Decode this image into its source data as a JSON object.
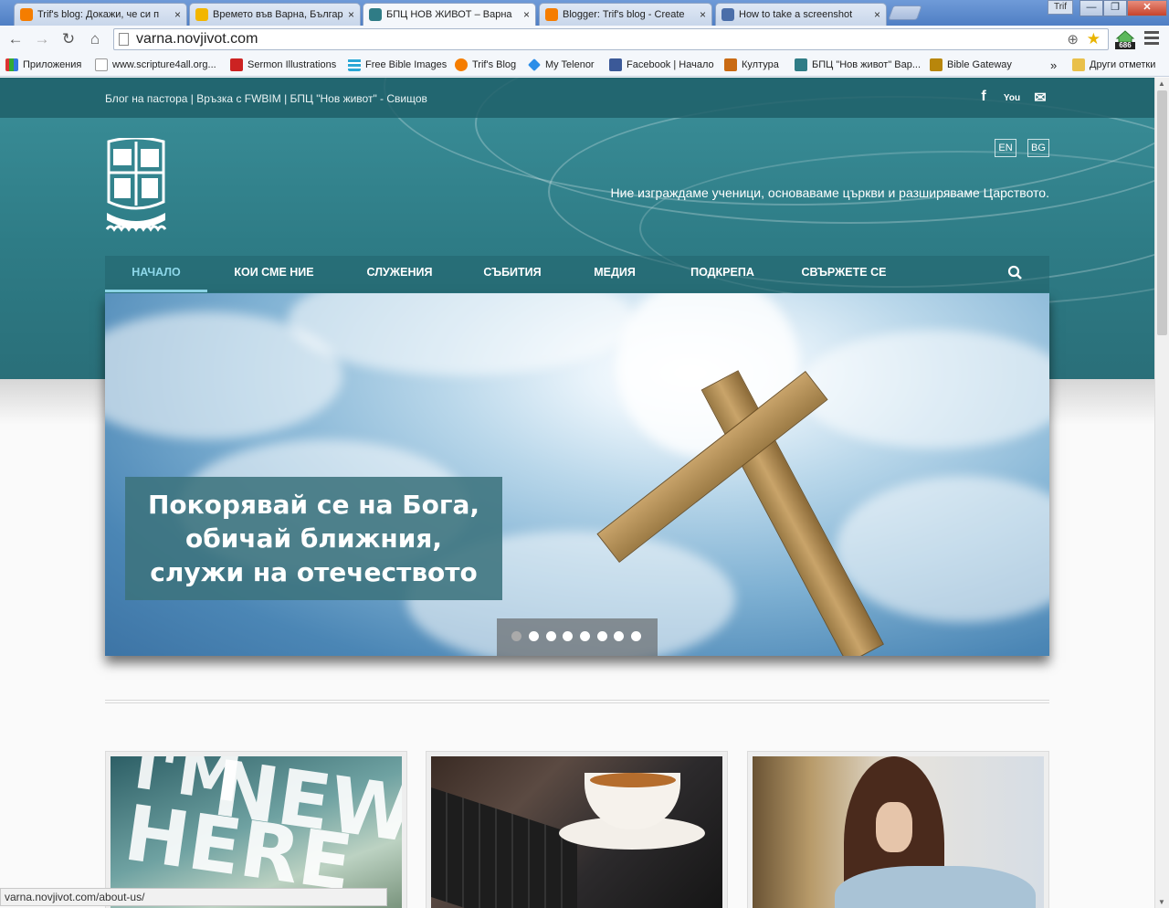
{
  "browser": {
    "tabs": [
      {
        "title": "Trif's blog: Докажи, че си п",
        "favicon_color": "#f57d00",
        "active": false
      },
      {
        "title": "Времето във Варна, Българ",
        "favicon_color": "#f2b600",
        "active": false
      },
      {
        "title": "БПЦ НОВ ЖИВОТ – Варна",
        "favicon_color": "#2f7c86",
        "active": true
      },
      {
        "title": "Blogger: Trif's blog - Create ",
        "favicon_color": "#f57d00",
        "active": false
      },
      {
        "title": "How to take a screenshot",
        "favicon_color": "#4a6ea9",
        "active": false
      }
    ],
    "tab_close": "×",
    "profile_label": "Trif",
    "window_controls": {
      "minimize": "—",
      "restore": "❐",
      "close": "✕"
    },
    "url": "varna.novjivot.com",
    "extension_badge": "686",
    "nav_icons": {
      "back": "←",
      "forward": "→",
      "reload": "↻",
      "home": "⌂"
    },
    "omnibox_icons": {
      "zoom": "⊕",
      "star": "★"
    },
    "bookmarks": [
      {
        "label": "Приложения",
        "icon_color": "#d33"
      },
      {
        "label": "www.scripture4all.org...",
        "icon_color": "#ffffff"
      },
      {
        "label": "Sermon Illustrations",
        "icon_color": "#c22"
      },
      {
        "label": "Free Bible Images",
        "icon_color": "#2aa7d6"
      },
      {
        "label": "Trif's Blog",
        "icon_color": "#f57d00"
      },
      {
        "label": "My Telenor",
        "icon_color": "#2b8ee8"
      },
      {
        "label": "Facebook | Начало",
        "icon_color": "#3b5998"
      },
      {
        "label": "Култура",
        "icon_color": "#c96a13"
      },
      {
        "label": "БПЦ \"Нов живот\" Вар...",
        "icon_color": "#2f7c86"
      },
      {
        "label": "Bible Gateway",
        "icon_color": "#b8860b"
      }
    ],
    "bookmarks_more": "»",
    "other_bookmarks": "Други отметки",
    "status_url": "varna.novjivot.com/about-us/"
  },
  "site": {
    "top_links": "Блог на пастора  |  Връзка с FWBIM  |  БПЦ \"Нов живот\" - Свищов",
    "social": {
      "facebook": "f",
      "youtube": "You",
      "mail": "✉"
    },
    "lang": {
      "en": "EN",
      "bg": "BG"
    },
    "tagline": "Ние изграждаме ученици, основаваме църкви и разширяваме Царството.",
    "nav": [
      "НАЧАЛО",
      "КОИ СМЕ НИЕ",
      "СЛУЖЕНИЯ",
      "СЪБИТИЯ",
      "МЕДИЯ",
      "ПОДКРЕПА",
      "СВЪРЖЕТЕ СЕ"
    ],
    "nav_active_index": 0,
    "slider": {
      "caption_line1": "Покорявай се на Бога,",
      "caption_line2": "обичай ближния,",
      "caption_line3": "служи на отечеството",
      "slide_count": 8,
      "active_slide": 1
    },
    "cards": [
      {
        "image_text_1": "I'M",
        "image_text_2": "NEW",
        "image_text_3": "HERE"
      },
      {
        "image_subject": "coffee-and-laptop"
      },
      {
        "image_subject": "praying-woman"
      }
    ]
  }
}
